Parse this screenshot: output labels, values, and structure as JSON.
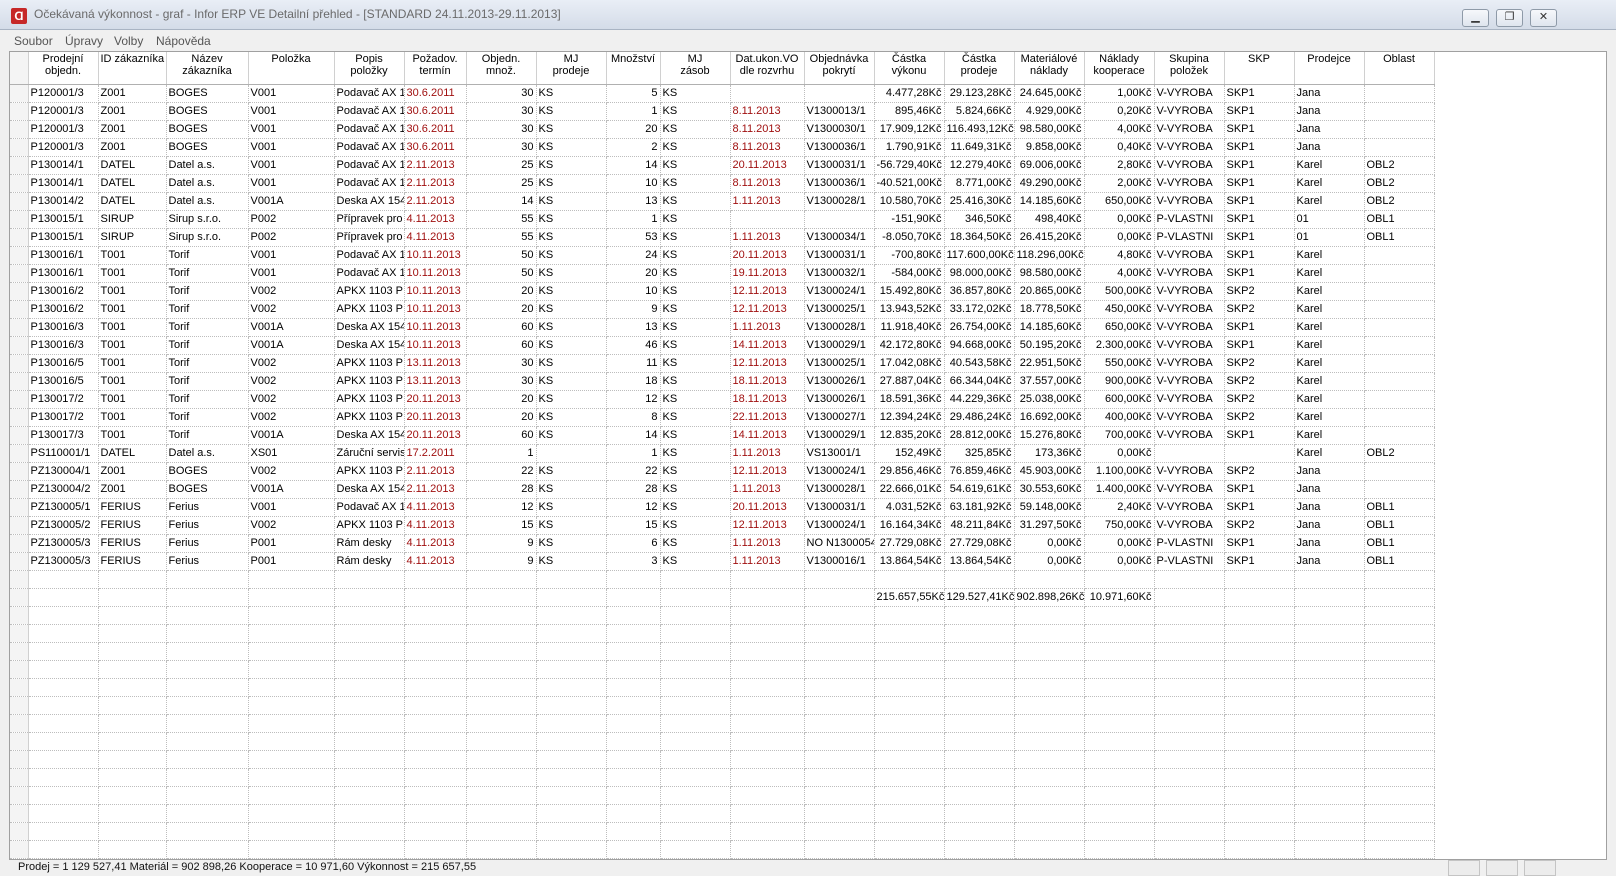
{
  "window": {
    "title": "Očekávaná výkonnost - graf - Infor ERP VE Detailní přehled - [STANDARD    24.11.2013-29.11.2013]",
    "icon": "app-logo-icon"
  },
  "menu": [
    "Soubor",
    "Úpravy",
    "Volby",
    "Nápověda"
  ],
  "columns": [
    "Prodejní\nobjedn.",
    "ID zákazníka",
    "Název\nzákazníka",
    "Položka",
    "Popis\npoložky",
    "Požadov.\ntermín",
    "Objedn.\nmnož.",
    "MJ\nprodeje",
    "Množství",
    "MJ\nzásob",
    "Dat.ukon.VO\ndle rozvrhu",
    "Objednávka\npokrytí",
    "Částka\nvýkonu",
    "Částka\nprodeje",
    "Materiálové\nnáklady",
    "Náklady\nkooperace",
    "Skupina\npoložek",
    "SKP",
    "Prodejce",
    "Oblast"
  ],
  "rows": [
    [
      "P120001/3",
      "Z001",
      "BOGES",
      "V001",
      "Podavač AX 1",
      "30.6.2011",
      "30",
      "KS",
      "5",
      "KS",
      "",
      "",
      "4.477,28Kč",
      "29.123,28Kč",
      "24.645,00Kč",
      "1,00Kč",
      "V-VYROBA",
      "SKP1",
      "Jana",
      ""
    ],
    [
      "P120001/3",
      "Z001",
      "BOGES",
      "V001",
      "Podavač AX 1",
      "30.6.2011",
      "30",
      "KS",
      "1",
      "KS",
      "8.11.2013",
      "V1300013/1",
      "895,46Kč",
      "5.824,66Kč",
      "4.929,00Kč",
      "0,20Kč",
      "V-VYROBA",
      "SKP1",
      "Jana",
      ""
    ],
    [
      "P120001/3",
      "Z001",
      "BOGES",
      "V001",
      "Podavač AX 1",
      "30.6.2011",
      "30",
      "KS",
      "20",
      "KS",
      "8.11.2013",
      "V1300030/1",
      "17.909,12Kč",
      "116.493,12Kč",
      "98.580,00Kč",
      "4,00Kč",
      "V-VYROBA",
      "SKP1",
      "Jana",
      ""
    ],
    [
      "P120001/3",
      "Z001",
      "BOGES",
      "V001",
      "Podavač AX 1",
      "30.6.2011",
      "30",
      "KS",
      "2",
      "KS",
      "8.11.2013",
      "V1300036/1",
      "1.790,91Kč",
      "11.649,31Kč",
      "9.858,00Kč",
      "0,40Kč",
      "V-VYROBA",
      "SKP1",
      "Jana",
      ""
    ],
    [
      "P130014/1",
      "DATEL",
      "Datel a.s.",
      "V001",
      "Podavač AX 1",
      "2.11.2013",
      "25",
      "KS",
      "14",
      "KS",
      "20.11.2013",
      "V1300031/1",
      "-56.729,40Kč",
      "12.279,40Kč",
      "69.006,00Kč",
      "2,80Kč",
      "V-VYROBA",
      "SKP1",
      "Karel",
      "OBL2"
    ],
    [
      "P130014/1",
      "DATEL",
      "Datel a.s.",
      "V001",
      "Podavač AX 1",
      "2.11.2013",
      "25",
      "KS",
      "10",
      "KS",
      "8.11.2013",
      "V1300036/1",
      "-40.521,00Kč",
      "8.771,00Kč",
      "49.290,00Kč",
      "2,00Kč",
      "V-VYROBA",
      "SKP1",
      "Karel",
      "OBL2"
    ],
    [
      "P130014/2",
      "DATEL",
      "Datel a.s.",
      "V001A",
      "Deska AX 154",
      "2.11.2013",
      "14",
      "KS",
      "13",
      "KS",
      "1.11.2013",
      "V1300028/1",
      "10.580,70Kč",
      "25.416,30Kč",
      "14.185,60Kč",
      "650,00Kč",
      "V-VYROBA",
      "SKP1",
      "Karel",
      "OBL2"
    ],
    [
      "P130015/1",
      "SIRUP",
      "Sirup s.r.o.",
      "P002",
      "Přípravek pro",
      "4.11.2013",
      "55",
      "KS",
      "1",
      "KS",
      "",
      "",
      "-151,90Kč",
      "346,50Kč",
      "498,40Kč",
      "0,00Kč",
      "P-VLASTNI",
      "SKP1",
      "01",
      "OBL1"
    ],
    [
      "P130015/1",
      "SIRUP",
      "Sirup s.r.o.",
      "P002",
      "Přípravek pro",
      "4.11.2013",
      "55",
      "KS",
      "53",
      "KS",
      "1.11.2013",
      "V1300034/1",
      "-8.050,70Kč",
      "18.364,50Kč",
      "26.415,20Kč",
      "0,00Kč",
      "P-VLASTNI",
      "SKP1",
      "01",
      "OBL1"
    ],
    [
      "P130016/1",
      "T001",
      "Torif",
      "V001",
      "Podavač AX 1",
      "10.11.2013",
      "50",
      "KS",
      "24",
      "KS",
      "20.11.2013",
      "V1300031/1",
      "-700,80Kč",
      "117.600,00Kč",
      "118.296,00Kč",
      "4,80Kč",
      "V-VYROBA",
      "SKP1",
      "Karel",
      ""
    ],
    [
      "P130016/1",
      "T001",
      "Torif",
      "V001",
      "Podavač AX 1",
      "10.11.2013",
      "50",
      "KS",
      "20",
      "KS",
      "19.11.2013",
      "V1300032/1",
      "-584,00Kč",
      "98.000,00Kč",
      "98.580,00Kč",
      "4,00Kč",
      "V-VYROBA",
      "SKP1",
      "Karel",
      ""
    ],
    [
      "P130016/2",
      "T001",
      "Torif",
      "V002",
      "APKX 1103 PI",
      "10.11.2013",
      "20",
      "KS",
      "10",
      "KS",
      "12.11.2013",
      "V1300024/1",
      "15.492,80Kč",
      "36.857,80Kč",
      "20.865,00Kč",
      "500,00Kč",
      "V-VYROBA",
      "SKP2",
      "Karel",
      ""
    ],
    [
      "P130016/2",
      "T001",
      "Torif",
      "V002",
      "APKX 1103 PI",
      "10.11.2013",
      "20",
      "KS",
      "9",
      "KS",
      "12.11.2013",
      "V1300025/1",
      "13.943,52Kč",
      "33.172,02Kč",
      "18.778,50Kč",
      "450,00Kč",
      "V-VYROBA",
      "SKP2",
      "Karel",
      ""
    ],
    [
      "P130016/3",
      "T001",
      "Torif",
      "V001A",
      "Deska AX 154",
      "10.11.2013",
      "60",
      "KS",
      "13",
      "KS",
      "1.11.2013",
      "V1300028/1",
      "11.918,40Kč",
      "26.754,00Kč",
      "14.185,60Kč",
      "650,00Kč",
      "V-VYROBA",
      "SKP1",
      "Karel",
      ""
    ],
    [
      "P130016/3",
      "T001",
      "Torif",
      "V001A",
      "Deska AX 154",
      "10.11.2013",
      "60",
      "KS",
      "46",
      "KS",
      "14.11.2013",
      "V1300029/1",
      "42.172,80Kč",
      "94.668,00Kč",
      "50.195,20Kč",
      "2.300,00Kč",
      "V-VYROBA",
      "SKP1",
      "Karel",
      ""
    ],
    [
      "P130016/5",
      "T001",
      "Torif",
      "V002",
      "APKX 1103 PI",
      "13.11.2013",
      "30",
      "KS",
      "11",
      "KS",
      "12.11.2013",
      "V1300025/1",
      "17.042,08Kč",
      "40.543,58Kč",
      "22.951,50Kč",
      "550,00Kč",
      "V-VYROBA",
      "SKP2",
      "Karel",
      ""
    ],
    [
      "P130016/5",
      "T001",
      "Torif",
      "V002",
      "APKX 1103 PI",
      "13.11.2013",
      "30",
      "KS",
      "18",
      "KS",
      "18.11.2013",
      "V1300026/1",
      "27.887,04Kč",
      "66.344,04Kč",
      "37.557,00Kč",
      "900,00Kč",
      "V-VYROBA",
      "SKP2",
      "Karel",
      ""
    ],
    [
      "P130017/2",
      "T001",
      "Torif",
      "V002",
      "APKX 1103 PI",
      "20.11.2013",
      "20",
      "KS",
      "12",
      "KS",
      "18.11.2013",
      "V1300026/1",
      "18.591,36Kč",
      "44.229,36Kč",
      "25.038,00Kč",
      "600,00Kč",
      "V-VYROBA",
      "SKP2",
      "Karel",
      ""
    ],
    [
      "P130017/2",
      "T001",
      "Torif",
      "V002",
      "APKX 1103 PI",
      "20.11.2013",
      "20",
      "KS",
      "8",
      "KS",
      "22.11.2013",
      "V1300027/1",
      "12.394,24Kč",
      "29.486,24Kč",
      "16.692,00Kč",
      "400,00Kč",
      "V-VYROBA",
      "SKP2",
      "Karel",
      ""
    ],
    [
      "P130017/3",
      "T001",
      "Torif",
      "V001A",
      "Deska AX 154",
      "20.11.2013",
      "60",
      "KS",
      "14",
      "KS",
      "14.11.2013",
      "V1300029/1",
      "12.835,20Kč",
      "28.812,00Kč",
      "15.276,80Kč",
      "700,00Kč",
      "V-VYROBA",
      "SKP1",
      "Karel",
      ""
    ],
    [
      "PS110001/1",
      "DATEL",
      "Datel a.s.",
      "XS01",
      "Záruční servis",
      "17.2.2011",
      "1",
      "",
      "1",
      "KS",
      "1.11.2013",
      "VS13001/1",
      "152,49Kč",
      "325,85Kč",
      "173,36Kč",
      "0,00Kč",
      "",
      "",
      "Karel",
      "OBL2"
    ],
    [
      "PZ130004/1",
      "Z001",
      "BOGES",
      "V002",
      "APKX 1103 PI",
      "2.11.2013",
      "22",
      "KS",
      "22",
      "KS",
      "12.11.2013",
      "V1300024/1",
      "29.856,46Kč",
      "76.859,46Kč",
      "45.903,00Kč",
      "1.100,00Kč",
      "V-VYROBA",
      "SKP2",
      "Jana",
      ""
    ],
    [
      "PZ130004/2",
      "Z001",
      "BOGES",
      "V001A",
      "Deska AX 154",
      "2.11.2013",
      "28",
      "KS",
      "28",
      "KS",
      "1.11.2013",
      "V1300028/1",
      "22.666,01Kč",
      "54.619,61Kč",
      "30.553,60Kč",
      "1.400,00Kč",
      "V-VYROBA",
      "SKP1",
      "Jana",
      ""
    ],
    [
      "PZ130005/1",
      "FERIUS",
      "Ferius",
      "V001",
      "Podavač AX 1",
      "4.11.2013",
      "12",
      "KS",
      "12",
      "KS",
      "20.11.2013",
      "V1300031/1",
      "4.031,52Kč",
      "63.181,92Kč",
      "59.148,00Kč",
      "2,40Kč",
      "V-VYROBA",
      "SKP1",
      "Jana",
      "OBL1"
    ],
    [
      "PZ130005/2",
      "FERIUS",
      "Ferius",
      "V002",
      "APKX 1103 PI",
      "4.11.2013",
      "15",
      "KS",
      "15",
      "KS",
      "12.11.2013",
      "V1300024/1",
      "16.164,34Kč",
      "48.211,84Kč",
      "31.297,50Kč",
      "750,00Kč",
      "V-VYROBA",
      "SKP2",
      "Jana",
      "OBL1"
    ],
    [
      "PZ130005/3",
      "FERIUS",
      "Ferius",
      "P001",
      "Rám desky",
      "4.11.2013",
      "9",
      "KS",
      "6",
      "KS",
      "1.11.2013",
      "NO N1300054",
      "27.729,08Kč",
      "27.729,08Kč",
      "0,00Kč",
      "0,00Kč",
      "P-VLASTNI",
      "SKP1",
      "Jana",
      "OBL1"
    ],
    [
      "PZ130005/3",
      "FERIUS",
      "Ferius",
      "P001",
      "Rám desky",
      "4.11.2013",
      "9",
      "KS",
      "3",
      "KS",
      "1.11.2013",
      "V1300016/1",
      "13.864,54Kč",
      "13.864,54Kč",
      "0,00Kč",
      "0,00Kč",
      "P-VLASTNI",
      "SKP1",
      "Jana",
      "OBL1"
    ]
  ],
  "totals": {
    "vykon": "215.657,55Kč",
    "prodej": "129.527,41Kč",
    "material": "902.898,26Kč",
    "kooperace": "10.971,60Kč"
  },
  "status": "Prodej = 1 129 527,41  Materiál = 902 898,26  Kooperace = 10 971,60  Výkonnost = 215 657,55"
}
